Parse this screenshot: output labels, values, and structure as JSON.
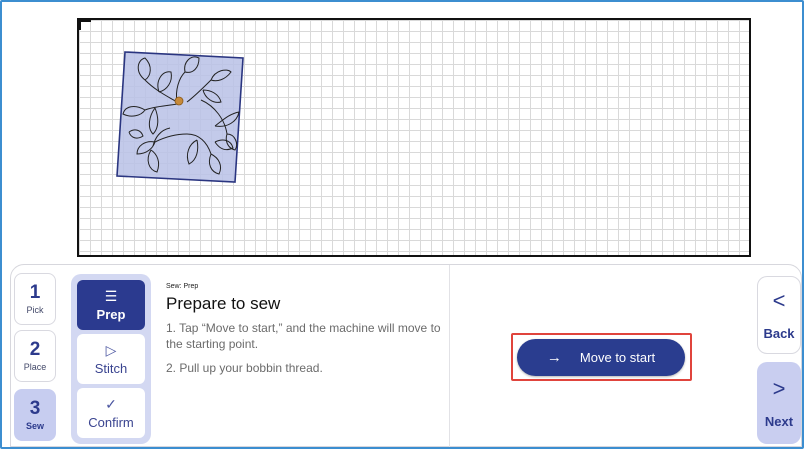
{
  "steps": [
    {
      "num": "1",
      "label": "Pick"
    },
    {
      "num": "2",
      "label": "Place"
    },
    {
      "num": "3",
      "label": "Sew"
    }
  ],
  "active_step": "Sew",
  "substeps": [
    {
      "icon": "checklist-icon",
      "glyph": "☰",
      "label": "Prep"
    },
    {
      "icon": "play-outline-icon",
      "glyph": "▷",
      "label": "Stitch"
    },
    {
      "icon": "checkmark-icon",
      "glyph": "✓",
      "label": "Confirm"
    }
  ],
  "active_substep": "Prep",
  "instructions": {
    "breadcrumb": "Sew: Prep",
    "title": "Prepare to sew",
    "line1": "1. Tap “Move to start,” and the machine will move to the starting point.",
    "line2": "2. Pull up your bobbin thread."
  },
  "action": {
    "label": "Move to start",
    "icon": "arrow-right-icon",
    "arrow": "→"
  },
  "nav": {
    "back_label": "Back",
    "back_glyph": "<",
    "next_label": "Next",
    "next_glyph": ">"
  },
  "colors": {
    "primary": "#2a3d8f",
    "accent_light": "#c9cef0",
    "highlight": "#e0443c",
    "frame": "#3c8ed0"
  }
}
